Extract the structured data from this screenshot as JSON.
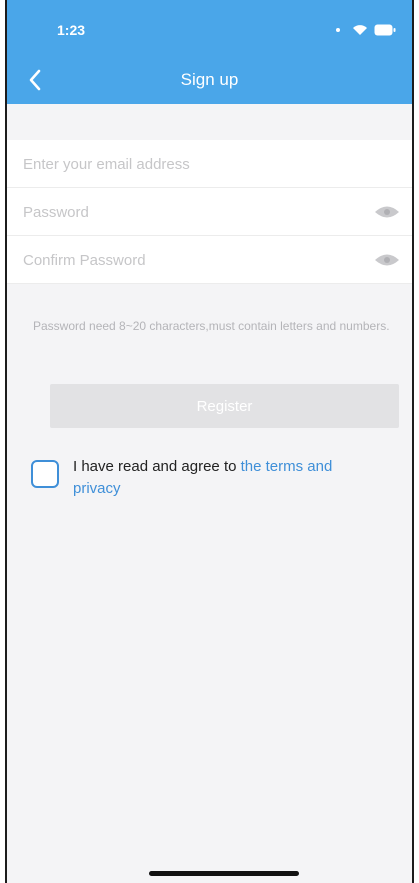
{
  "status_bar": {
    "time": "1:23"
  },
  "nav": {
    "title": "Sign up",
    "back_icon": "chevron-left-icon"
  },
  "form": {
    "email_placeholder": "Enter your email address",
    "password_placeholder": "Password",
    "confirm_placeholder": "Confirm Password",
    "eye_icon": "eye-icon",
    "hint": "Password need 8~20 characters,must contain letters and numbers.",
    "register_label": "Register"
  },
  "agreement": {
    "text": "I have read and agree to ",
    "link": "the terms and privacy"
  },
  "colors": {
    "header": "#4aa6e9",
    "link": "#3f8fd8",
    "button_disabled": "#e2e2e4",
    "background": "#f4f4f6"
  }
}
